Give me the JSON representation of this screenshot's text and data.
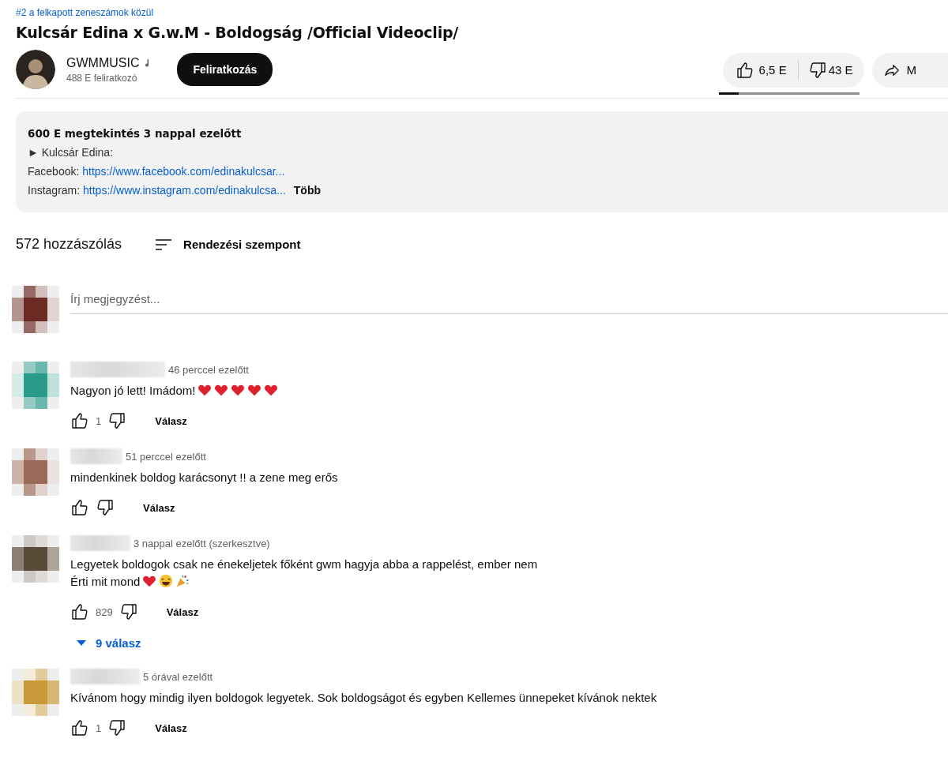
{
  "trending": "#2 a felkapott zeneszámok közül",
  "title": "Kulcsár Edina x G.w.M - Boldogság /Official Videoclip/",
  "channel": {
    "name": "GWMMUSIC",
    "subscribers": "488 E feliratkozó",
    "subscribe": "Feliratkozás"
  },
  "likes": {
    "like_count": "6,5 E",
    "dislike_count": "43 E",
    "level": 0.14
  },
  "share": {
    "label": "M"
  },
  "description": {
    "stats": "600 E megtekintés  3 nappal ezelőtt",
    "lines": [
      {
        "label": "► Kulcsár Edina:"
      },
      {
        "label": "Facebook: ",
        "link": "https://www.facebook.com/edinakulcsar..."
      },
      {
        "label": "Instagram: ",
        "link": "https://www.instagram.com/edinakulcsa...",
        "more": "Több"
      }
    ]
  },
  "comments_header": {
    "count": "572 hozzászólás",
    "sort": "Rendezési szempont"
  },
  "new_comment": {
    "placeholder": "Írj megjegyzést...",
    "color": "#6b2a22"
  },
  "comments": [
    {
      "time": "46 perccel ezelőtt",
      "text": "Nagyon jó lett! Imádom!",
      "emoji": [
        {
          "kind": "heart"
        },
        {
          "kind": "heart"
        },
        {
          "kind": "heart"
        },
        {
          "kind": "heart"
        },
        {
          "kind": "heart"
        }
      ],
      "likes": "1",
      "reply": "Válasz",
      "color": "#2a9a8a"
    },
    {
      "time": "51 perccel ezelőtt",
      "text": "mindenkinek boldog karácsonyt !! a zene meg erős",
      "reply": "Válasz",
      "color": "#9a6a58"
    },
    {
      "time": "3 nappal ezelőtt (szerkesztve)",
      "text": "Legyetek boldogok csak ne énekeljetek főként gwm hagyja abba a rappelést, ember nem\nÉrti mit mond",
      "emoji": [
        {
          "kind": "heart"
        },
        {
          "kind": "laugh"
        },
        {
          "kind": "party"
        }
      ],
      "likes": "829",
      "reply": "Válasz",
      "replies": "9 válasz",
      "color": "#5a4a38"
    },
    {
      "time": "5 órával ezelőtt",
      "text": "Kívánom hogy mindig ilyen boldogok legyetek. Sok boldogságot és egyben Kellemes ünnepeket kívánok nektek",
      "likes": "1",
      "reply": "Válasz",
      "color": "#c89a3a"
    }
  ]
}
